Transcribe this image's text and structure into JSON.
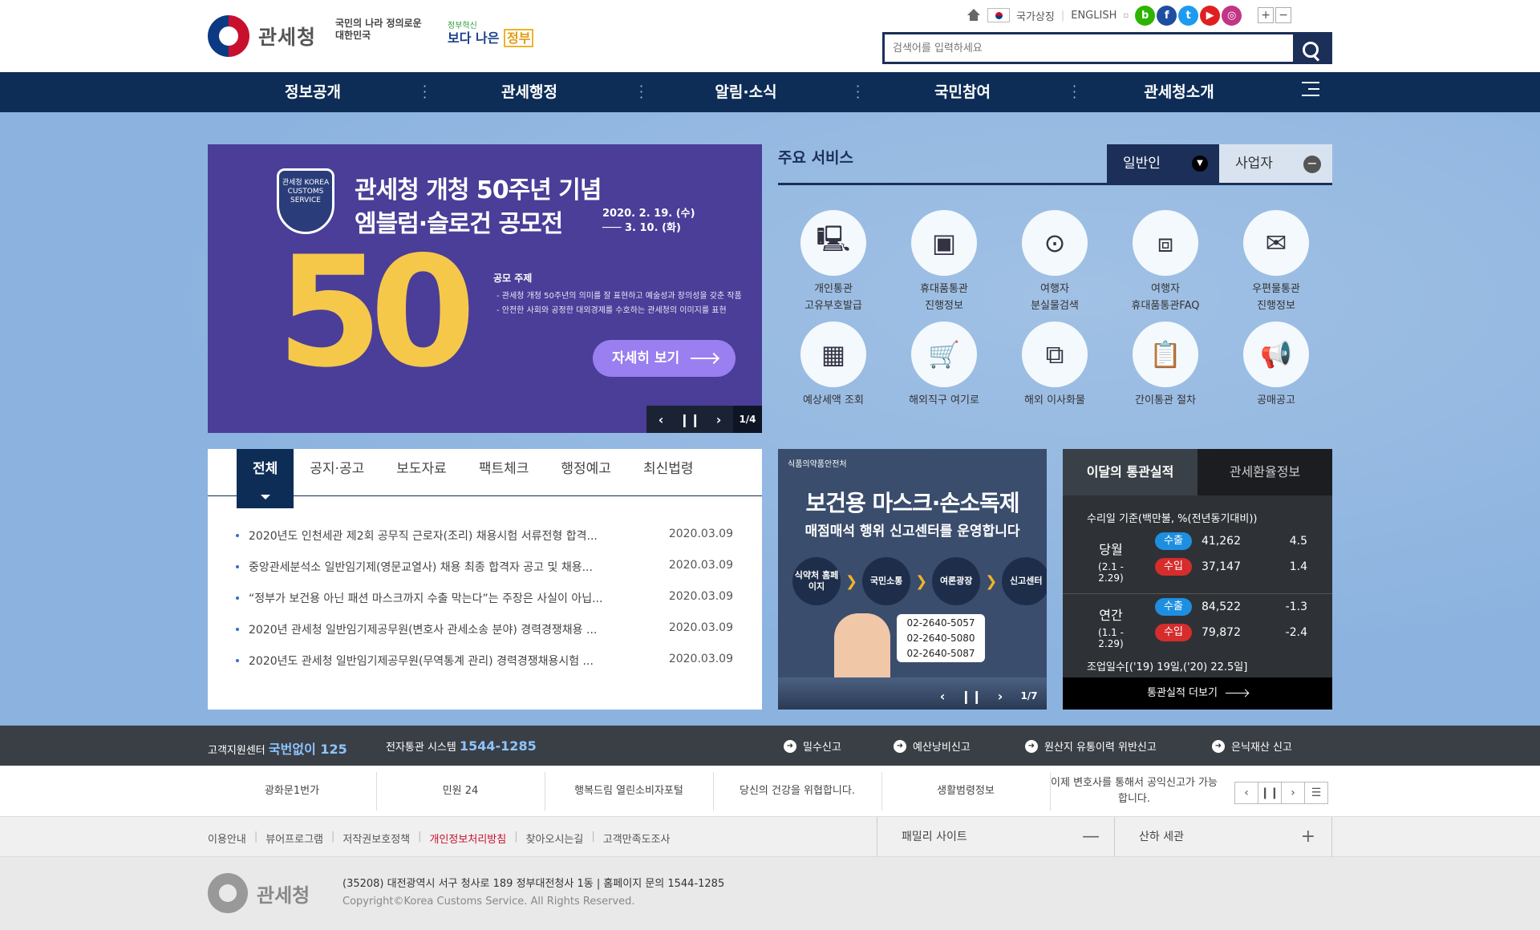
{
  "header": {
    "logo_text": "관세청",
    "slogan1": "국민의 나라 정의로운 대한민국",
    "slogan2_small": "정부혁신",
    "slogan2_main": "보다 나은",
    "slogan2_box": "정부",
    "util_symbol": "국가상징",
    "util_english": "ENGLISH",
    "search_placeholder": "검색어를 입력하세요"
  },
  "gnb": [
    "정보공개",
    "관세행정",
    "알림·소식",
    "국민참여",
    "관세청소개"
  ],
  "banner": {
    "shield_text": "관세청 KOREA CUSTOMS SERVICE",
    "title1": "관세청 개청 50주년 기념",
    "title2": "엠블럼·슬로건 공모전",
    "date1": "2020. 2. 19. (수)",
    "date2": "─── 3. 10. (화)",
    "big": "50",
    "topic_title": "공모 주제",
    "topic1": "- 관세청 개청 50주년의 의미를 잘 표현하고 예술성과 창의성을 갖춘 작품",
    "topic2": "- 안전한 사회와 공정한 대외경제를 수호하는 관세청의 이미지를 표현",
    "more": "자세히 보기",
    "page": "1/4"
  },
  "services": {
    "title": "주요 서비스",
    "tab_general": "일반인",
    "tab_business": "사업자",
    "items": [
      {
        "l1": "개인통관",
        "l2": "고유부호발급"
      },
      {
        "l1": "휴대품통관",
        "l2": "진행정보"
      },
      {
        "l1": "여행자",
        "l2": "분실물검색"
      },
      {
        "l1": "여행자",
        "l2": "휴대품통관FAQ"
      },
      {
        "l1": "우편물통관",
        "l2": "진행정보"
      },
      {
        "l1": "예상세액 조회",
        "l2": ""
      },
      {
        "l1": "해외직구 여기로",
        "l2": ""
      },
      {
        "l1": "해외 이사화물",
        "l2": ""
      },
      {
        "l1": "간이통관 절차",
        "l2": ""
      },
      {
        "l1": "공매공고",
        "l2": ""
      }
    ]
  },
  "news": {
    "tabs": [
      "전체",
      "공지·공고",
      "보도자료",
      "팩트체크",
      "행정예고",
      "최신법령"
    ],
    "items": [
      {
        "title": "2020년도 인천세관 제2회 공무직 근로자(조리) 채용시험 서류전형 합격...",
        "date": "2020.03.09"
      },
      {
        "title": "중앙관세분석소 일반임기제(영문교열사) 채용 최종 합격자 공고 및 채용...",
        "date": "2020.03.09"
      },
      {
        "title": "“정부가 보건용 아닌 패션 마스크까지 수출 막는다”는 주장은 사실이 아닙...",
        "date": "2020.03.09"
      },
      {
        "title": "2020년 관세청 일반임기제공무원(변호사 관세소송 분야) 경력경쟁채용 ...",
        "date": "2020.03.09"
      },
      {
        "title": "2020년도 관세청 일반임기제공무원(무역통계 관리) 경력경쟁채용시험 ...",
        "date": "2020.03.09"
      }
    ]
  },
  "promo": {
    "org": "식품의약품안전처",
    "h1": "보건용 마스크·손소독제",
    "h2": "매점매석 행위 신고센터를 운영합니다",
    "steps": [
      "식약처 홈페이지",
      "국민소통",
      "여론광장",
      "신고센터"
    ],
    "phones": [
      "02-2640-5057",
      "02-2640-5080",
      "02-2640-5087"
    ],
    "page": "1/7"
  },
  "stats": {
    "tab_on": "이달의 통관실적",
    "tab_off": "관세환율정보",
    "basis": "수리일 기준(백만불, %(전년동기대비))",
    "month_label": "당월",
    "month_range": "(2.1 - 2.29)",
    "year_label": "연간",
    "year_range": "(1.1 - 2.29)",
    "exp_label": "수출",
    "imp_label": "수입",
    "month_exp": "41,262",
    "month_exp_pct": "4.5",
    "month_imp": "37,147",
    "month_imp_pct": "1.4",
    "year_exp": "84,522",
    "year_exp_pct": "-1.3",
    "year_imp": "79,872",
    "year_imp_pct": "-2.4",
    "days": "조업일수[('19) 19일,('20) 22.5일]",
    "more": "통관실적 더보기"
  },
  "infobar": {
    "cs_label": "고객지원센터",
    "cs_num": "국번없이 125",
    "edi_label": "전자통관 시스템",
    "edi_num": "1544-1285",
    "reports": [
      "밀수신고",
      "예산낭비신고",
      "원산지 유통이력 위반신고",
      "은닉재산 신고"
    ]
  },
  "related": [
    "광화문1번가",
    "민원 24",
    "행복드림 열린소비자포털",
    "당신의 건강을 위협합니다.",
    "생활범령정보",
    "이제 변호사를 통해서 공익신고가 가능합니다."
  ],
  "footnav": {
    "links": [
      "이용안내",
      "뷰어프로그램",
      "저작권보호정책",
      "개인정보처리방침",
      "찾아오시는길",
      "고객만족도조사"
    ],
    "family": "패밀리 사이트",
    "customs": "산하 세관"
  },
  "footer": {
    "logo_text": "관세청",
    "address": "(35208) 대전광역시 서구 청사로 189 정부대전청사 1동  |  홈페이지 문의 1544-1285",
    "copyright": "Copyright©Korea Customs Service. All Rights Reserved."
  }
}
